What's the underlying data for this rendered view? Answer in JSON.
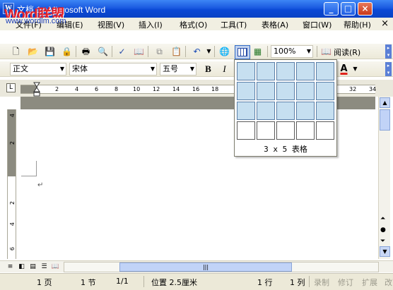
{
  "window": {
    "title": "文档 1 - Microsoft Word",
    "watermark_logo": "Word联盟",
    "watermark_url": "www.wordlm.com",
    "controls": [
      "minimize",
      "maximize",
      "close"
    ]
  },
  "menubar": {
    "items": [
      "文件(F)",
      "编辑(E)",
      "视图(V)",
      "插入(I)",
      "格式(O)",
      "工具(T)",
      "表格(A)",
      "窗口(W)",
      "帮助(H)"
    ],
    "close_glyph": "×"
  },
  "toolbar1": {
    "zoom": "100%",
    "read_label": "阅读(R)",
    "icons": [
      "new-icon",
      "open-icon",
      "save-icon",
      "permission-icon",
      "print-icon",
      "print-preview-icon",
      "spelling-icon",
      "research-icon",
      "copy-icon",
      "paste-icon",
      "undo-icon",
      "hyperlink-icon",
      "insert-table-icon",
      "insert-excel-icon",
      "read-icon"
    ]
  },
  "toolbar2": {
    "style": "正文",
    "font": "宋体",
    "size": "五号",
    "bold": "B",
    "italic": "I",
    "font_color_letter": "A",
    "font_color": "#e0241c"
  },
  "ruler": {
    "ticks": [
      "2",
      "4",
      "6",
      "8",
      "10",
      "12",
      "14",
      "16",
      "18",
      "32",
      "34"
    ],
    "vticks": [
      "4",
      "2",
      "2",
      "4",
      "6"
    ],
    "tab_glyph": "L"
  },
  "table_picker": {
    "rows": 4,
    "cols": 5,
    "selected_rows": 3,
    "selected_cols": 5,
    "label": "3 x 5 表格"
  },
  "document": {
    "paragraph_mark": "↵"
  },
  "statusbar": {
    "page": "1 页",
    "section": "1 节",
    "page_of": "1/1",
    "position": "位置 2.5厘米",
    "line": "1 行",
    "column": "1 列",
    "rec": "录制",
    "trk": "修订",
    "ext": "扩展",
    "ovr": "改写"
  },
  "colors": {
    "titlebar": "#0b49d6",
    "selection": "#c6dff0",
    "ruler_margin": "#8c8b80"
  }
}
